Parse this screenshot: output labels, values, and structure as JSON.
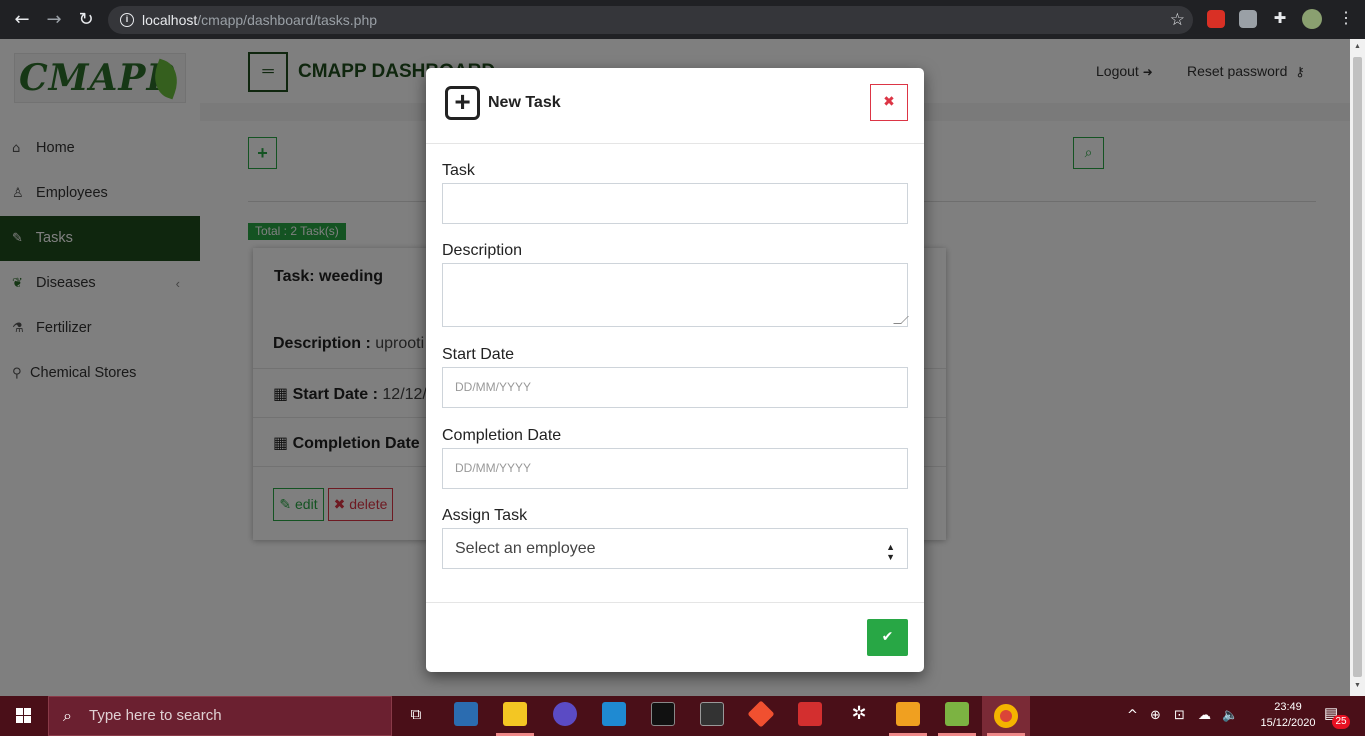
{
  "browser": {
    "url_host": "localhost",
    "url_path": "/cmapp/dashboard/tasks.php"
  },
  "sidebar": {
    "logo_text": "CMAPP",
    "items": [
      {
        "label": "Home",
        "icon": "home-icon"
      },
      {
        "label": "Employees",
        "icon": "user-icon"
      },
      {
        "label": "Tasks",
        "icon": "wrench-icon",
        "active": true
      },
      {
        "label": "Diseases",
        "icon": "leaf-icon",
        "has_submenu": true
      },
      {
        "label": "Fertilizer",
        "icon": "flask-icon"
      },
      {
        "label": "Chemical Stores",
        "icon": "map-marker-icon"
      }
    ]
  },
  "header": {
    "title": "CMAPP DASHBOARD",
    "logout_label": "Logout",
    "reset_password_label": "Reset password"
  },
  "tasks": {
    "total_label": "Total : 2 Task(s)",
    "card": {
      "task_label": "Task: weeding",
      "description_label": "Description :",
      "description_value": "uprooti",
      "start_date_label": "Start Date :",
      "start_date_value": "12/12/",
      "completion_date_label": "Completion Date",
      "edit_label": "edit",
      "delete_label": "delete"
    }
  },
  "modal": {
    "title": "New Task",
    "fields": {
      "task_label": "Task",
      "task_value": "",
      "description_label": "Description",
      "description_value": "",
      "start_date_label": "Start Date",
      "start_date_placeholder": "DD/MM/YYYY",
      "completion_date_label": "Completion Date",
      "completion_date_placeholder": "DD/MM/YYYY",
      "assign_label": "Assign Task",
      "assign_selected": "Select an employee"
    }
  },
  "taskbar": {
    "search_placeholder": "Type here to search",
    "time": "23:49",
    "date": "15/12/2020",
    "notification_count": "25"
  },
  "colors": {
    "brand_dark_green": "#1e4d1c",
    "accent_green": "#28a745",
    "danger_red": "#dc3545",
    "taskbar": "#4a0f18"
  }
}
